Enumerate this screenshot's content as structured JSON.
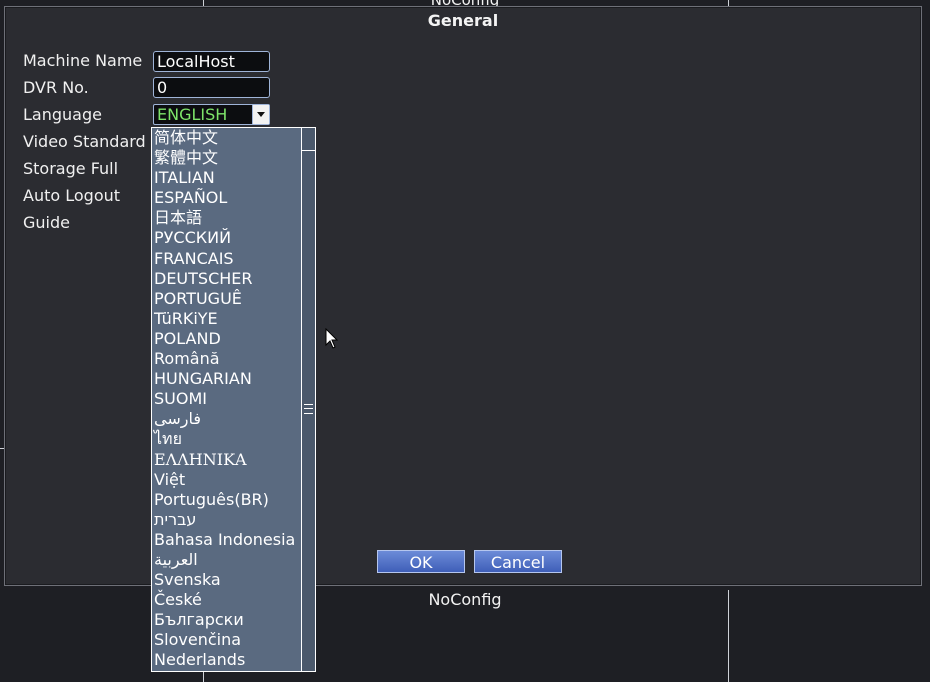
{
  "background": {
    "top_label": "NoConfig",
    "bottom_label": "NoConfig"
  },
  "dialog": {
    "title": "General",
    "fields": [
      {
        "label": "Machine Name",
        "value": "LocalHost"
      },
      {
        "label": "DVR No.",
        "value": "0"
      },
      {
        "label": "Language",
        "value": "ENGLISH"
      },
      {
        "label": "Video Standard"
      },
      {
        "label": "Storage Full"
      },
      {
        "label": "Auto Logout"
      },
      {
        "label": "Guide"
      }
    ],
    "ok_label": "OK",
    "cancel_label": "Cancel"
  },
  "language_dropdown": {
    "selected": "ENGLISH",
    "options": [
      "简体中文",
      "繁體中文",
      "ITALIAN",
      "ESPAÑOL",
      "日本語",
      "РУССКИЙ",
      "FRANCAIS",
      "DEUTSCHER",
      "PORTUGUÊ",
      "TüRKiYE",
      "POLAND",
      "Română",
      "HUNGARIAN",
      "SUOMI",
      "فارسی",
      "ไทย",
      "ΕΛΛΗΝΙΚΑ",
      "Việt",
      "Português(BR)",
      "עברית",
      "Bahasa Indonesia",
      "العربية",
      "Svenska",
      "České",
      "Български",
      "Slovenčina",
      "Nederlands"
    ]
  },
  "colors": {
    "dialog_bg": "#2b2c31",
    "dropdown_bg": "#5a6a80",
    "selected_value": "#7ee36a",
    "button": "#4f6fc8"
  }
}
